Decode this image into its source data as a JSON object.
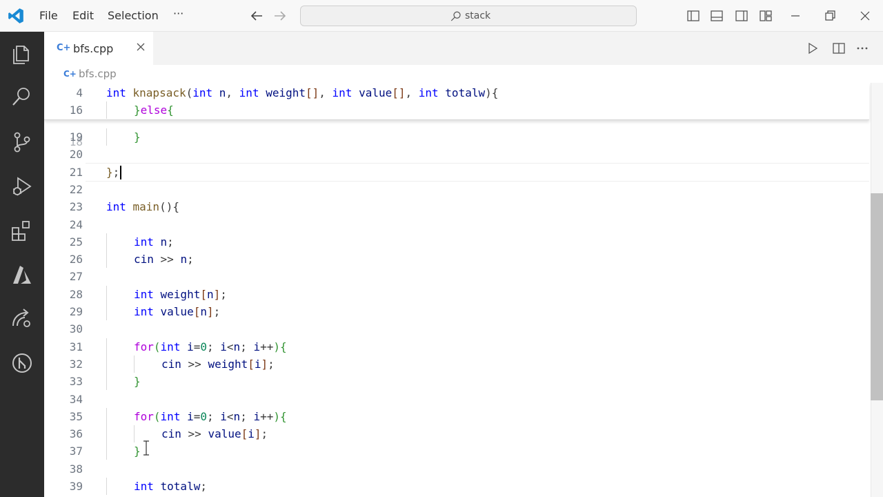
{
  "menu": {
    "file": "File",
    "edit": "Edit",
    "selection": "Selection",
    "more": "···"
  },
  "search": {
    "text": "stack"
  },
  "tab": {
    "name": "bfs.cpp",
    "icon": "C+"
  },
  "breadcrumb": {
    "name": "bfs.cpp",
    "icon": "C+"
  },
  "sticky": [
    {
      "num": "4",
      "indent": 0,
      "tokens": [
        [
          "kw",
          "int "
        ],
        [
          "fn",
          "knapsack"
        ],
        [
          "",
          "("
        ],
        [
          "kw",
          "int "
        ],
        [
          "var",
          "n"
        ],
        [
          "",
          ", "
        ],
        [
          "kw",
          "int "
        ],
        [
          "var",
          "weight"
        ],
        [
          "br2",
          "[]"
        ],
        [
          "",
          ", "
        ],
        [
          "kw",
          "int "
        ],
        [
          "var",
          "value"
        ],
        [
          "br2",
          "[]"
        ],
        [
          "",
          ", "
        ],
        [
          "kw",
          "int "
        ],
        [
          "var",
          "totalw"
        ],
        [
          "",
          ")"
        ],
        [
          "",
          "{"
        ]
      ]
    },
    {
      "num": "16",
      "indent": 1,
      "tokens": [
        [
          "br",
          "}"
        ],
        [
          "ctl",
          "else"
        ],
        [
          "br",
          "{"
        ]
      ]
    }
  ],
  "lines": [
    {
      "num": "19",
      "indent": 1,
      "tokens": [
        [
          "br",
          "}"
        ]
      ]
    },
    {
      "num": "20",
      "indent": 0,
      "tokens": []
    },
    {
      "num": "21",
      "indent": 0,
      "tokens": [
        [
          "fn",
          "}"
        ],
        [
          "",
          ";"
        ]
      ]
    },
    {
      "num": "22",
      "indent": 0,
      "tokens": []
    },
    {
      "num": "23",
      "indent": 0,
      "tokens": [
        [
          "kw",
          "int "
        ],
        [
          "fn",
          "main"
        ],
        [
          "",
          "(){"
        ]
      ]
    },
    {
      "num": "24",
      "indent": 0,
      "tokens": []
    },
    {
      "num": "25",
      "indent": 1,
      "tokens": [
        [
          "kw",
          "int "
        ],
        [
          "var",
          "n"
        ],
        [
          "",
          ";"
        ]
      ]
    },
    {
      "num": "26",
      "indent": 1,
      "tokens": [
        [
          "var",
          "cin"
        ],
        [
          "",
          " >> "
        ],
        [
          "var",
          "n"
        ],
        [
          "",
          ";"
        ]
      ]
    },
    {
      "num": "27",
      "indent": 0,
      "tokens": []
    },
    {
      "num": "28",
      "indent": 1,
      "tokens": [
        [
          "kw",
          "int "
        ],
        [
          "var",
          "weight"
        ],
        [
          "br2",
          "["
        ],
        [
          "var",
          "n"
        ],
        [
          "br2",
          "]"
        ],
        [
          "",
          ";"
        ]
      ]
    },
    {
      "num": "29",
      "indent": 1,
      "tokens": [
        [
          "kw",
          "int "
        ],
        [
          "var",
          "value"
        ],
        [
          "br2",
          "["
        ],
        [
          "var",
          "n"
        ],
        [
          "br2",
          "]"
        ],
        [
          "",
          ";"
        ]
      ]
    },
    {
      "num": "30",
      "indent": 0,
      "tokens": []
    },
    {
      "num": "31",
      "indent": 1,
      "tokens": [
        [
          "ctl",
          "for"
        ],
        [
          "br",
          "("
        ],
        [
          "kw",
          "int "
        ],
        [
          "var",
          "i"
        ],
        [
          "",
          "="
        ],
        [
          "num",
          "0"
        ],
        [
          "",
          "; "
        ],
        [
          "var",
          "i"
        ],
        [
          "",
          "<"
        ],
        [
          "var",
          "n"
        ],
        [
          "",
          "; "
        ],
        [
          "var",
          "i"
        ],
        [
          "",
          "++"
        ],
        [
          "br",
          ")"
        ],
        [
          "br",
          "{"
        ]
      ]
    },
    {
      "num": "32",
      "indent": 2,
      "tokens": [
        [
          "var",
          "cin"
        ],
        [
          "",
          " >> "
        ],
        [
          "var",
          "weight"
        ],
        [
          "br2",
          "["
        ],
        [
          "var",
          "i"
        ],
        [
          "br2",
          "]"
        ],
        [
          "",
          ";"
        ]
      ]
    },
    {
      "num": "33",
      "indent": 1,
      "tokens": [
        [
          "br",
          "}"
        ]
      ]
    },
    {
      "num": "34",
      "indent": 0,
      "tokens": []
    },
    {
      "num": "35",
      "indent": 1,
      "tokens": [
        [
          "ctl",
          "for"
        ],
        [
          "br",
          "("
        ],
        [
          "kw",
          "int "
        ],
        [
          "var",
          "i"
        ],
        [
          "",
          "="
        ],
        [
          "num",
          "0"
        ],
        [
          "",
          "; "
        ],
        [
          "var",
          "i"
        ],
        [
          "",
          "<"
        ],
        [
          "var",
          "n"
        ],
        [
          "",
          "; "
        ],
        [
          "var",
          "i"
        ],
        [
          "",
          "++"
        ],
        [
          "br",
          ")"
        ],
        [
          "br",
          "{"
        ]
      ]
    },
    {
      "num": "36",
      "indent": 2,
      "tokens": [
        [
          "var",
          "cin"
        ],
        [
          "",
          " >> "
        ],
        [
          "var",
          "value"
        ],
        [
          "br2",
          "["
        ],
        [
          "var",
          "i"
        ],
        [
          "br2",
          "]"
        ],
        [
          "",
          ";"
        ]
      ]
    },
    {
      "num": "37",
      "indent": 1,
      "tokens": [
        [
          "br",
          "}"
        ]
      ]
    },
    {
      "num": "38",
      "indent": 0,
      "tokens": []
    },
    {
      "num": "39",
      "indent": 1,
      "tokens": [
        [
          "kw",
          "int "
        ],
        [
          "var",
          "totalw"
        ],
        [
          "",
          ";"
        ]
      ]
    }
  ],
  "colors": {
    "activity_bar": "#2c2c2c",
    "keyword": "#0000ff",
    "control": "#af00db",
    "function": "#795e26",
    "variable": "#001080",
    "number": "#098658"
  }
}
